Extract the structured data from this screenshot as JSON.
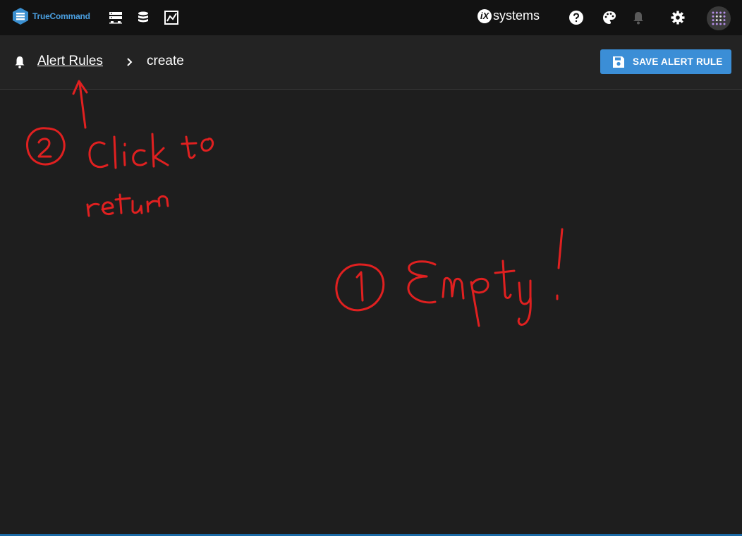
{
  "topbar": {
    "app_name": "TrueCommand",
    "brand_badge": "iX",
    "brand_text": "systems",
    "icons": [
      "servers-icon",
      "database-icon",
      "chart-icon",
      "help-icon",
      "palette-icon",
      "bell-icon",
      "gear-icon",
      "avatar"
    ]
  },
  "breadcrumb": {
    "parent": "Alert Rules",
    "current": "create"
  },
  "actions": {
    "save_label": "SAVE ALERT RULE"
  },
  "colors": {
    "accent": "#3b8ed6",
    "topbar_bg": "#121212",
    "subheader_bg": "#232323",
    "content_bg": "#1e1e1e",
    "annotation": "#e02020"
  }
}
